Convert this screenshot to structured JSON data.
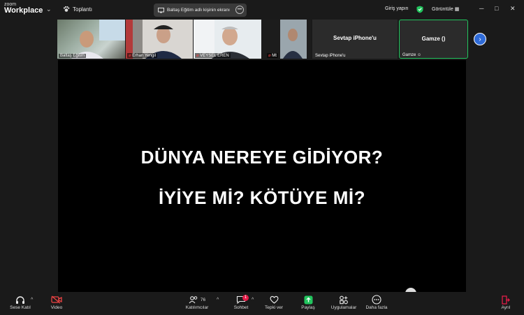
{
  "app": {
    "brand_small": "zoom",
    "brand_big": "Workplace"
  },
  "header": {
    "meeting_label": "Toplantı",
    "share_label": "Baltaş Eğitim adlı kişinin ekranı",
    "signin_label": "Giriş yapın",
    "view_label": "Görüntüle"
  },
  "participants": [
    {
      "name": "Baltaş Eğitim"
    },
    {
      "name": "Erhan Yengil"
    },
    {
      "name": "VEYSEL EREN"
    },
    {
      "name": "Mt"
    },
    {
      "name": "Sevtap iPhone'u",
      "center": "Sevtap iPhone'u"
    },
    {
      "name": "Gamze",
      "center": "Gamze ()"
    }
  ],
  "slide": {
    "line1": "DÜNYA NEREYE GİDİYOR?",
    "line2": "İYİYE Mİ? KÖTÜYE Mİ?"
  },
  "toolbar": {
    "audio": "Sese Katıl",
    "video": "Video",
    "participants": "Katılımcılar",
    "participants_count": "76",
    "chat": "Sohbet",
    "chat_badge": "1",
    "react": "Tepki ver",
    "share": "Paylaş",
    "apps": "Uygulamalar",
    "more": "Daha fazla",
    "leave": "Ayrıl"
  },
  "colors": {
    "accent": "#2f6bd8",
    "share_green": "#22c55e",
    "leave_red": "#e11d48"
  }
}
